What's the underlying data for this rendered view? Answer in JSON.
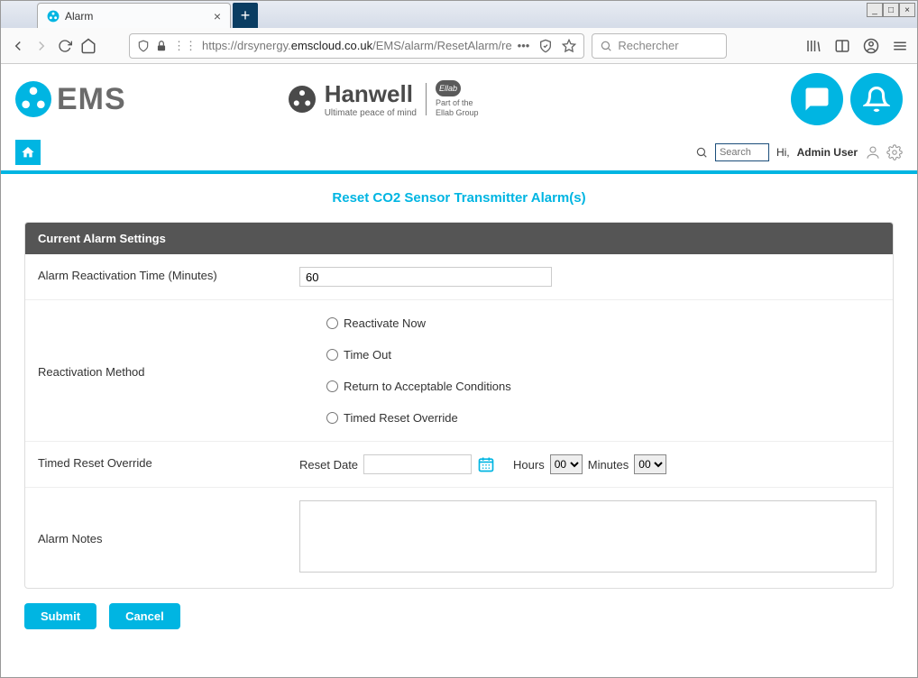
{
  "browser": {
    "tab_title": "Alarm",
    "url_prefix": "https://drsynergy.",
    "url_domain": "emscloud.co.uk",
    "url_path": "/EMS/alarm/ResetAlarm/re",
    "search_placeholder": "Rechercher"
  },
  "header": {
    "ems_text": "EMS",
    "hanwell_name": "Hanwell",
    "hanwell_sub": "Ultimate peace of mind",
    "ellab_logo": "Ellab",
    "ellab_text1": "Part of the",
    "ellab_text2": "Ellab Group"
  },
  "subheader": {
    "search_placeholder": "Search",
    "greeting": "Hi,",
    "username": "Admin User"
  },
  "page_title": "Reset CO2 Sensor Transmitter Alarm(s)",
  "panel": {
    "header": "Current Alarm Settings",
    "reactivation_time_label": "Alarm Reactivation Time (Minutes)",
    "reactivation_time_value": "60",
    "reactivation_method_label": "Reactivation Method",
    "radios": {
      "reactivate_now": "Reactivate Now",
      "time_out": "Time Out",
      "return_acceptable": "Return to Acceptable Conditions",
      "timed_reset": "Timed Reset Override"
    },
    "timed_override_label": "Timed Reset Override",
    "reset_date_label": "Reset Date",
    "hours_label": "Hours",
    "hours_value": "00",
    "minutes_label": "Minutes",
    "minutes_value": "00",
    "alarm_notes_label": "Alarm Notes"
  },
  "buttons": {
    "submit": "Submit",
    "cancel": "Cancel"
  }
}
